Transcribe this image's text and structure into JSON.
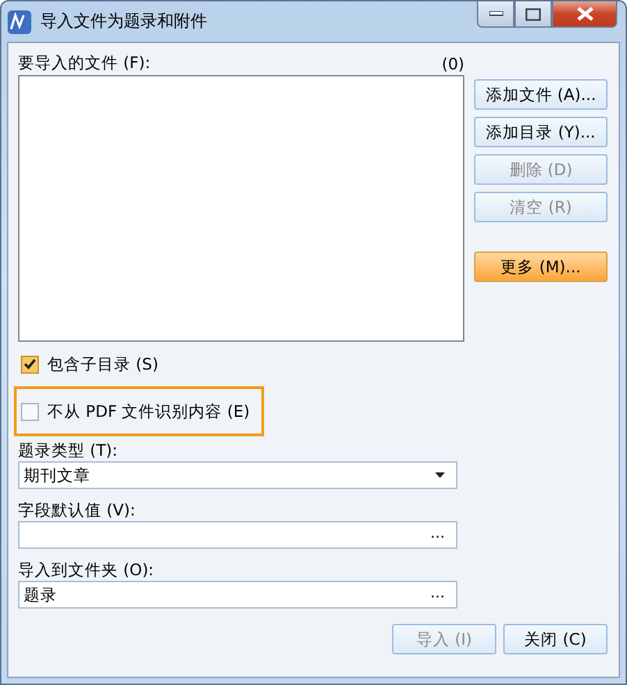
{
  "window": {
    "title": "导入文件为题录和附件"
  },
  "file_list": {
    "label": "要导入的文件 (F):",
    "count": "(0)"
  },
  "side_buttons": [
    {
      "label": "添加文件 (A)...",
      "disabled": false,
      "kind": "normal"
    },
    {
      "label": "添加目录 (Y)...",
      "disabled": false,
      "kind": "normal"
    },
    {
      "label": "删除 (D)",
      "disabled": true,
      "kind": "normal"
    },
    {
      "label": "清空 (R)",
      "disabled": true,
      "kind": "normal"
    },
    {
      "label": "更多 (M)...",
      "disabled": false,
      "kind": "accent"
    }
  ],
  "checkboxes": [
    {
      "label": "包含子目录 (S)",
      "checked": true,
      "highlighted": false
    },
    {
      "label": "不从 PDF 文件识别内容 (E)",
      "checked": false,
      "highlighted": true
    }
  ],
  "fields": [
    {
      "label": "题录类型 (T):",
      "value": "期刊文章",
      "kind": "dropdown"
    },
    {
      "label": "字段默认值 (V):",
      "kind": "browse",
      "button": "..."
    },
    {
      "label": "导入到文件夹 (O):",
      "value": "题录",
      "kind": "browse",
      "button": "..."
    }
  ],
  "buttons": [
    {
      "label": "导入 (I)",
      "disabled": true
    },
    {
      "label": "关闭 (C)",
      "disabled": false
    }
  ]
}
